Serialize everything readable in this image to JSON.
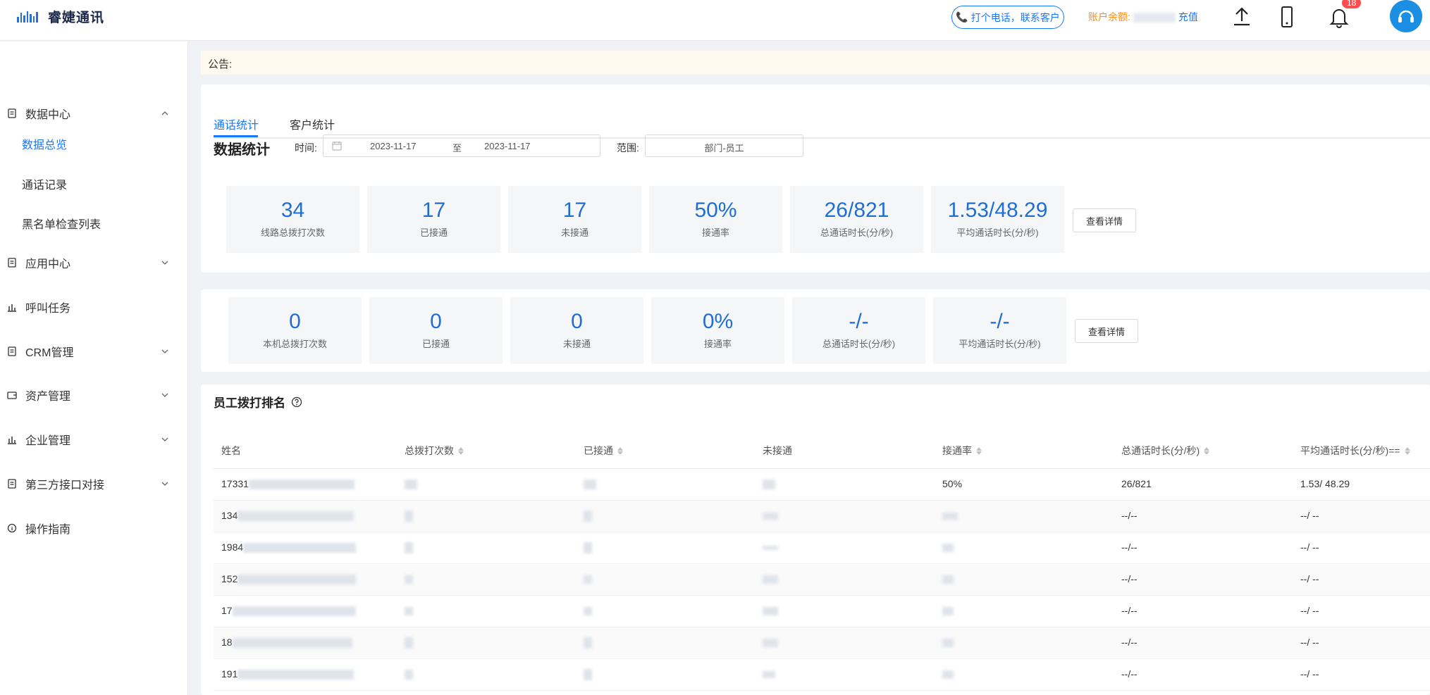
{
  "header": {
    "brand": "睿婕通讯",
    "call_button": "打个电话，联系客户",
    "balance_label": "账户余额:",
    "recharge": "充值",
    "notification_count": "18"
  },
  "sidebar": {
    "items": [
      {
        "label": "数据中心",
        "icon": "file-icon",
        "expanded": true
      },
      {
        "label": "应用中心",
        "icon": "file-icon"
      },
      {
        "label": "呼叫任务",
        "icon": "bar-chart-icon"
      },
      {
        "label": "CRM管理",
        "icon": "file-icon"
      },
      {
        "label": "资产管理",
        "icon": "wallet-icon"
      },
      {
        "label": "企业管理",
        "icon": "bar-chart-icon"
      },
      {
        "label": "第三方接口对接",
        "icon": "file-icon"
      },
      {
        "label": "操作指南",
        "icon": "info-icon"
      }
    ],
    "sub_items": [
      "数据总览",
      "通话记录",
      "黑名单检查列表"
    ]
  },
  "notice": {
    "label": "公告:"
  },
  "tabs": [
    "通话统计",
    "客户统计"
  ],
  "filters": {
    "title": "数据统计",
    "time_label": "时间:",
    "start_date": "2023-11-17",
    "separator": "至",
    "end_date": "2023-11-17",
    "range_label": "范围:",
    "range_value": "部门-员工"
  },
  "line_stats": [
    {
      "value": "34",
      "label": "线路总拨打次数"
    },
    {
      "value": "17",
      "label": "已接通"
    },
    {
      "value": "17",
      "label": "未接通"
    },
    {
      "value": "50%",
      "label": "接通率"
    },
    {
      "value": "26/821",
      "label": "总通话时长(分/秒)"
    },
    {
      "value": "1.53/48.29",
      "label": "平均通话时长(分/秒)"
    }
  ],
  "local_stats": [
    {
      "value": "0",
      "label": "本机总拨打次数"
    },
    {
      "value": "0",
      "label": "已接通"
    },
    {
      "value": "0",
      "label": "未接通"
    },
    {
      "value": "0%",
      "label": "接通率"
    },
    {
      "value": "-/-",
      "label": "总通话时长(分/秒)"
    },
    {
      "value": "-/-",
      "label": "平均通话时长(分/秒)"
    }
  ],
  "detail_button": "查看详情",
  "ranking": {
    "title": "员工拨打排名",
    "columns": [
      "姓名",
      "总拨打次数",
      "已接通",
      "未接通",
      "接通率",
      "总通话时长(分/秒)",
      "平均通话时长(分/秒)=="
    ],
    "rows": [
      {
        "name": "17331",
        "rate": "50%",
        "total": "26/821",
        "avg": "1.53/ 48.29"
      },
      {
        "name": "134",
        "rate": "",
        "total": "--/--",
        "avg": "--/ --"
      },
      {
        "name": "1984",
        "rate": "",
        "total": "--/--",
        "avg": "--/ --"
      },
      {
        "name": "152",
        "rate": "",
        "total": "--/--",
        "avg": "--/ --"
      },
      {
        "name": "17",
        "rate": "",
        "total": "--/--",
        "avg": "--/ --"
      },
      {
        "name": "18",
        "rate": "",
        "total": "--/--",
        "avg": "--/ --"
      },
      {
        "name": "191",
        "rate": "",
        "total": "--/--",
        "avg": "--/ --"
      }
    ]
  }
}
